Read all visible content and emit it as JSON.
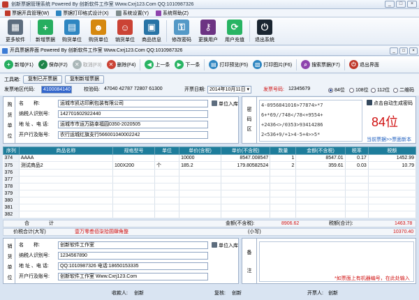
{
  "window": {
    "title": "创新票据管理系统 Powered By 创新软件工作室 Www.Cxrj123.Com QQ:1010987326",
    "controls": [
      "_",
      "□",
      "×"
    ]
  },
  "menu": [
    {
      "label": "票据开具管理(W)",
      "color": "#c0392b"
    },
    {
      "label": "票据打印格式设计(X)",
      "color": "#2e86c1"
    },
    {
      "label": "系统设置(Y)",
      "color": "#7f8c8d"
    },
    {
      "label": "系统帮助(Z)",
      "color": "#8e44ad"
    }
  ],
  "bigbar": [
    {
      "label": "更多软件",
      "icon": "grid-icon",
      "color": "#5d6d7e",
      "glyph": "▦"
    },
    {
      "label": "新增票据",
      "icon": "plus-icon",
      "color": "#27ae60",
      "glyph": "+"
    },
    {
      "label": "购货单位",
      "icon": "building-icon",
      "color": "#2e86c1",
      "glyph": "▤"
    },
    {
      "label": "购货单位",
      "icon": "people-icon",
      "color": "#d68910",
      "glyph": "☻"
    },
    {
      "label": "销货单位",
      "icon": "person-icon",
      "color": "#cb4335",
      "glyph": "☺"
    },
    {
      "label": "商品信息",
      "icon": "goods-icon",
      "color": "#2874a6",
      "glyph": "▣"
    },
    {
      "label": "修改密码",
      "icon": "key-icon",
      "color": "#5499c7",
      "glyph": "⚿"
    },
    {
      "label": "更换用户",
      "icon": "lock-icon",
      "color": "#6c3483",
      "glyph": "⚷"
    },
    {
      "label": "用户充值",
      "icon": "share-icon",
      "color": "#28b463",
      "glyph": "⟳"
    },
    {
      "label": "退出系统",
      "icon": "power-icon",
      "color": "#1b2631",
      "glyph": "⏻"
    }
  ],
  "subwindow": {
    "title": "开具票据界面 Powered By 创新软件工作室 Www.Cxrj123.Com QQ:1010987326"
  },
  "toolbar": [
    {
      "label": "新增(F1)",
      "icon": "add-icon",
      "color": "#27ae60",
      "glyph": "+",
      "enabled": true
    },
    {
      "label": "保存(F2)",
      "icon": "save-icon",
      "color": "#1e8449",
      "glyph": "✓",
      "enabled": true
    },
    {
      "label": "取消(F3)",
      "icon": "cancel-icon",
      "color": "#aab7b8",
      "glyph": "✕",
      "enabled": false
    },
    {
      "label": "删除(F4)",
      "icon": "delete-icon",
      "color": "#cb4335",
      "glyph": "✕",
      "enabled": true
    },
    {
      "label": "上一条",
      "icon": "prev-icon",
      "color": "#28b463",
      "glyph": "◀",
      "enabled": true
    },
    {
      "label": "下一条",
      "icon": "next-icon",
      "color": "#28b463",
      "glyph": "▶",
      "enabled": true
    },
    {
      "label": "打印预览(F5)",
      "icon": "preview-icon",
      "color": "#2e86c1",
      "glyph": "▤",
      "enabled": true
    },
    {
      "label": "打印图片(F6)",
      "icon": "print-image-icon",
      "color": "#2e86c1",
      "glyph": "▧",
      "enabled": true
    },
    {
      "label": "搜索票据(F7)",
      "icon": "search-icon",
      "color": "#8e44ad",
      "glyph": "⌕",
      "enabled": true
    },
    {
      "label": "退出界面",
      "icon": "exit-icon",
      "color": "#c0392b",
      "glyph": "⏻",
      "enabled": true
    }
  ],
  "tools": {
    "label": "工具箱:",
    "copy_issued": "复制已开票据",
    "copy_new": "复制新增票据"
  },
  "header": {
    "region_label": "发票地区代码:",
    "region_value": "4100084140",
    "check_label": "校验码:",
    "check_value": "47040 42787 72807 61300",
    "date_label": "开票日期:",
    "date_value": "2014年10月11日",
    "number_label": "发票号码:",
    "number_value": "12345679",
    "sizes": [
      "84位",
      "108位",
      "112位",
      "二维码"
    ],
    "size_selected": 0
  },
  "buyer": {
    "side": [
      "购",
      "货",
      "单",
      "位"
    ],
    "name_label": "名　　称:",
    "name": "运城市凯达印刷包装有限公司",
    "tax_label": "纳税人识别号:",
    "tax": "142701602922440",
    "addr_label": "地 址 、电 话:",
    "addr": "运城市市运万路幸福园0350-2020505",
    "bank_label": "开户行及账号:",
    "bank": "农行运城红旗支行566001040002242",
    "to_library": "单位入库"
  },
  "cipher": {
    "side": [
      "密",
      "码",
      "区"
    ],
    "lines": [
      "4-0956841016>77874>*7",
      "6+*69//748</78<+9554+",
      "+2436<>/0353>93414286",
      "2<536+9/+1>4-5+4>>5*"
    ],
    "gen_label": "点击自动生成密码",
    "big": "84位",
    "link": "当前票据>>票面新本"
  },
  "table": {
    "columns": [
      "序列",
      "商品名称",
      "规格型号",
      "单位",
      "单价(含税)",
      "单价(不含税)",
      "数量",
      "金额(不含税)",
      "税率",
      "税额"
    ],
    "rows": [
      [
        "374",
        "AAAA",
        "",
        "",
        "10000",
        "8547.008547",
        "1",
        "8547.01",
        "0.17",
        "1452.99"
      ],
      [
        "375",
        "测试商品2",
        "100X200",
        "个",
        "185.2",
        "179.80582524",
        "2",
        "359.61",
        "0.03",
        "10.79"
      ],
      [
        "376",
        "",
        "",
        "",
        "",
        "",
        "",
        "",
        "",
        ""
      ],
      [
        "377",
        "",
        "",
        "",
        "",
        "",
        "",
        "",
        "",
        ""
      ],
      [
        "378",
        "",
        "",
        "",
        "",
        "",
        "",
        "",
        "",
        ""
      ],
      [
        "379",
        "",
        "",
        "",
        "",
        "",
        "",
        "",
        "",
        ""
      ],
      [
        "380",
        "",
        "",
        "",
        "",
        "",
        "",
        "",
        "",
        ""
      ],
      [
        "381",
        "",
        "",
        "",
        "",
        "",
        "",
        "",
        "",
        ""
      ],
      [
        "382",
        "",
        "",
        "",
        "",
        "",
        "",
        "",
        "",
        ""
      ]
    ]
  },
  "totals": {
    "label": "合　　　　计",
    "amount_label": "金额(不含税):",
    "amount": "8906.62",
    "tax_label": "税额(合计):",
    "tax": "1463.78",
    "total_label": "价税合计(大写)",
    "total_words": "壹万零叁佰柒拾圆肆角整",
    "small_label": "(小写)",
    "small": "10370.40"
  },
  "seller": {
    "side": [
      "销",
      "货",
      "单",
      "位"
    ],
    "name_label": "名　　称:",
    "name": "创新软件工作室",
    "tax_label": "纳税人识别号:",
    "tax": "1234567890",
    "addr_label": "地 址 、电 话:",
    "addr": "QQ:1010987326 电话:18650153335",
    "bank_label": "开户行及账号:",
    "bank": "创新软件工作室 Www.Cxrj123.Com",
    "to_library": "单位入库"
  },
  "remark": {
    "side": [
      "备",
      "注"
    ],
    "note": "*如票面上有机器编号，在此处输入"
  },
  "signatures": {
    "payee_label": "收款人:",
    "payee": "创新",
    "review_label": "复核:",
    "review": "创新",
    "drawer_label": "开票人:",
    "drawer": "创新"
  }
}
